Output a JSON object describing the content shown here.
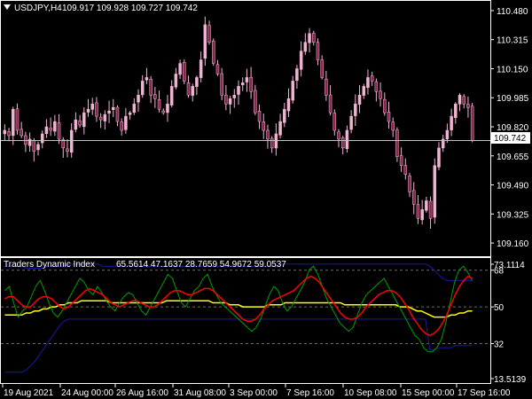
{
  "main_panel": {
    "header_symbol": "USDJPY,H4",
    "header_prices": "109.917 109.928 109.727 109.742",
    "price_ticks": [
      "110.480",
      "110.315",
      "110.150",
      "109.985",
      "109.820",
      "109.655",
      "109.490",
      "109.325",
      "109.160"
    ],
    "current_price_label": "109.742",
    "candle_color": "#f0b4d2"
  },
  "indicator_panel": {
    "title": "Traders Dynamic Index",
    "values_text": "65.5614 47.1637 28.7659 54.9672 59.0537",
    "level_ticks": [
      "73.1114",
      "68",
      "50",
      "32",
      "13.5139"
    ],
    "colors": {
      "bands": "#1a1aa8",
      "market_base": "#ffff00",
      "signal_line": "#ff0000",
      "rsi_price_line": "#00a000"
    }
  },
  "time_axis": {
    "labels": [
      "19 Aug 2021",
      "24 Aug 00:00",
      "26 Aug 16:00",
      "31 Aug 08:00",
      "3 Sep 00:00",
      "7 Sep 16:00",
      "10 Sep 08:00",
      "15 Sep 00:00",
      "17 Sep 16:00"
    ]
  },
  "chart_data": [
    {
      "type": "candlestick",
      "title": "USDJPY,H4",
      "ylim": [
        109.1,
        110.52
      ],
      "close": [
        109.8,
        109.77,
        109.92,
        109.8,
        109.77,
        109.72,
        109.75,
        109.68,
        109.72,
        109.78,
        109.82,
        109.8,
        109.85,
        109.75,
        109.7,
        109.68,
        109.8,
        109.86,
        109.83,
        109.9,
        109.92,
        109.95,
        109.88,
        109.86,
        109.89,
        109.91,
        109.93,
        109.85,
        109.8,
        109.88,
        109.9,
        109.95,
        110.0,
        110.08,
        110.1,
        110.0,
        109.98,
        109.92,
        109.9,
        109.95,
        110.05,
        110.12,
        110.18,
        110.08,
        110.0,
        110.05,
        110.1,
        110.2,
        110.4,
        110.3,
        110.18,
        110.12,
        110.0,
        109.95,
        109.98,
        110.0,
        110.05,
        110.07,
        110.1,
        110.02,
        109.9,
        109.85,
        109.8,
        109.75,
        109.7,
        109.78,
        109.85,
        109.92,
        109.98,
        110.08,
        110.15,
        110.25,
        110.3,
        110.35,
        110.3,
        110.2,
        110.1,
        110.0,
        109.9,
        109.8,
        109.75,
        109.7,
        109.8,
        109.88,
        109.95,
        110.0,
        110.05,
        110.1,
        110.08,
        110.02,
        109.98,
        109.9,
        109.85,
        109.8,
        109.65,
        109.6,
        109.55,
        109.45,
        109.38,
        109.3,
        109.35,
        109.4,
        109.3,
        109.6,
        109.7,
        109.75,
        109.8,
        109.88,
        109.95,
        110.0,
        109.95,
        109.93,
        109.742
      ]
    },
    {
      "type": "line",
      "title": "Traders Dynamic Index",
      "ylim": [
        13.5139,
        73.1114
      ],
      "series": [
        {
          "color": "#00a000",
          "values": [
            58,
            60,
            52,
            45,
            48,
            50,
            55,
            60,
            63,
            58,
            52,
            47,
            45,
            48,
            52,
            56,
            60,
            64,
            62,
            58,
            56,
            60,
            57,
            53,
            50,
            48,
            52,
            55,
            57,
            56,
            52,
            48,
            46,
            50,
            54,
            58,
            62,
            66,
            64,
            58,
            52,
            50,
            54,
            58,
            60,
            64,
            66,
            60,
            56,
            52,
            50,
            48,
            46,
            44,
            42,
            40,
            38,
            40,
            44,
            50,
            56,
            60,
            58,
            52,
            48,
            50,
            54,
            58,
            62,
            68,
            70,
            66,
            60,
            54,
            50,
            46,
            42,
            40,
            38,
            40,
            46,
            52,
            56,
            58,
            60,
            62,
            64,
            60,
            56,
            52,
            48,
            44,
            40,
            36,
            34,
            30,
            28,
            28,
            30,
            34,
            42,
            52,
            62,
            68,
            70,
            67,
            63
          ]
        },
        {
          "color": "#ff0000",
          "values": [
            54,
            55,
            55,
            53,
            51,
            50,
            50,
            52,
            54,
            55,
            55,
            54,
            52,
            50,
            49,
            50,
            52,
            54,
            56,
            58,
            59,
            58,
            57,
            56,
            54,
            52,
            51,
            50,
            51,
            52,
            53,
            53,
            52,
            51,
            50,
            50,
            51,
            53,
            55,
            57,
            58,
            58,
            57,
            56,
            56,
            57,
            58,
            59,
            59,
            58,
            56,
            54,
            52,
            50,
            48,
            46,
            44,
            43,
            43,
            44,
            46,
            49,
            51,
            53,
            54,
            55,
            56,
            57,
            58,
            60,
            62,
            64,
            65,
            64,
            62,
            59,
            56,
            53,
            50,
            47,
            45,
            44,
            44,
            45,
            47,
            50,
            52,
            54,
            56,
            57,
            58,
            58,
            57,
            55,
            52,
            49,
            45,
            42,
            39,
            37,
            36,
            37,
            39,
            42,
            46,
            51,
            56,
            60,
            63,
            65,
            64
          ]
        },
        {
          "color": "#ffff00",
          "values": [
            46,
            46,
            46,
            46,
            46,
            47,
            47,
            48,
            48,
            49,
            49,
            50,
            50,
            51,
            51,
            52,
            52,
            52,
            53,
            53,
            53,
            53,
            53,
            53,
            53,
            52,
            52,
            52,
            52,
            52,
            52,
            52,
            52,
            52,
            52,
            52,
            52,
            52,
            53,
            53,
            53,
            53,
            53,
            53,
            53,
            53,
            53,
            53,
            53,
            52,
            52,
            52,
            52,
            51,
            51,
            51,
            50,
            50,
            50,
            50,
            50,
            50,
            51,
            51,
            51,
            51,
            52,
            52,
            52,
            52,
            52,
            52,
            52,
            52,
            52,
            52,
            52,
            52,
            52,
            52,
            51,
            51,
            51,
            51,
            51,
            51,
            51,
            51,
            51,
            51,
            51,
            51,
            51,
            50,
            50,
            50,
            49,
            48,
            48,
            47,
            46,
            45,
            45,
            45,
            45,
            46,
            46,
            47,
            47,
            48,
            48
          ]
        },
        {
          "color": "#1a1aa8",
          "values": [
            70,
            70,
            70,
            70,
            70,
            69,
            69,
            69,
            69,
            69,
            70,
            70,
            70,
            70,
            70,
            71,
            71,
            71,
            71,
            71,
            71,
            71,
            71,
            70,
            70,
            70,
            70,
            70,
            70,
            70,
            70,
            70,
            70,
            70,
            70,
            70,
            70,
            70,
            70,
            70,
            70,
            70,
            70,
            70,
            70,
            70,
            70,
            70,
            70,
            70,
            70,
            70,
            70,
            70,
            70,
            70,
            70,
            70,
            70,
            70,
            70,
            70,
            70,
            70,
            70,
            71,
            71,
            71,
            71,
            71,
            71,
            71,
            71,
            71,
            71,
            71,
            71,
            71,
            71,
            71,
            71,
            71,
            71,
            71,
            71,
            71,
            71,
            71,
            71,
            71,
            71,
            71,
            71,
            71,
            71,
            71,
            71,
            71,
            71,
            71,
            70,
            68,
            66,
            64,
            63,
            63,
            63,
            63,
            63,
            63,
            63
          ]
        },
        {
          "color": "#1a1aa8",
          "values": [
            18,
            18,
            18,
            18,
            18,
            19,
            21,
            23,
            26,
            29,
            32,
            35,
            38,
            41,
            43,
            44,
            44,
            44,
            44,
            44,
            44,
            44,
            44,
            44,
            44,
            44,
            44,
            44,
            44,
            44,
            44,
            44,
            44,
            44,
            44,
            44,
            44,
            44,
            44,
            44,
            44,
            44,
            44,
            44,
            44,
            44,
            44,
            44,
            44,
            44,
            44,
            44,
            44,
            44,
            44,
            44,
            44,
            44,
            44,
            44,
            44,
            44,
            44,
            44,
            44,
            44,
            44,
            44,
            44,
            44,
            44,
            44,
            44,
            44,
            44,
            44,
            44,
            44,
            44,
            44,
            44,
            44,
            44,
            44,
            44,
            44,
            44,
            44,
            44,
            44,
            44,
            44,
            44,
            44,
            44,
            44,
            44,
            44,
            44,
            44,
            29,
            29,
            30,
            30,
            30,
            30,
            31,
            31,
            31,
            31,
            31
          ]
        }
      ]
    }
  ]
}
